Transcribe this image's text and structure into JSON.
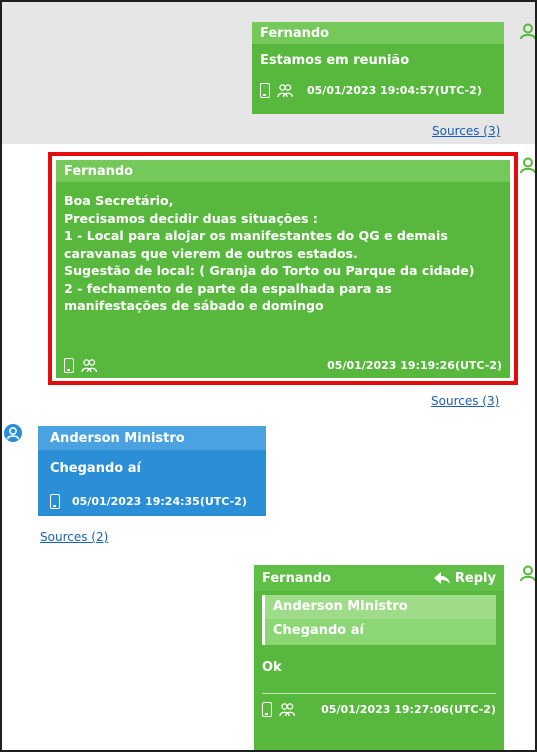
{
  "messages": [
    {
      "sender": "Fernando",
      "text": "Estamos em reunião",
      "timestamp": "05/01/2023 19:04:57(UTC-2)",
      "sources": "Sources (3)"
    },
    {
      "sender": "Fernando",
      "lines": [
        "Boa Secretário,",
        "Precisamos decidir duas situações :",
        "1 - Local para alojar os manifestantes do QG e demais",
        "caravanas que vierem de outros estados.",
        "Sugestão de local: ( Granja do Torto ou Parque da cidade)",
        "2 - fechamento de parte da espalhada para as",
        "manifestações de sábado e domingo"
      ],
      "timestamp": "05/01/2023 19:19:26(UTC-2)",
      "sources": "Sources (3)"
    },
    {
      "sender": "Anderson Ministro",
      "text": "Chegando aí",
      "timestamp": "05/01/2023 19:24:35(UTC-2)",
      "sources": "Sources (2)"
    },
    {
      "sender": "Fernando",
      "reply_label": "Reply",
      "quoted_sender": "Anderson Ministro",
      "quoted_text": "Chegando aí",
      "text": "Ok",
      "timestamp": "05/01/2023 19:27:06(UTC-2)"
    }
  ],
  "icons": {
    "phone": "phone-icon",
    "group": "group-icon",
    "avatar": "user-avatar-icon",
    "reply": "reply-arrow-icon"
  },
  "colors": {
    "green_bubble": "#58b83e",
    "green_header": "#74c95a",
    "blue_bubble": "#2a8fd6",
    "highlight_border": "#e30d0d",
    "link": "#1a5fb4"
  }
}
